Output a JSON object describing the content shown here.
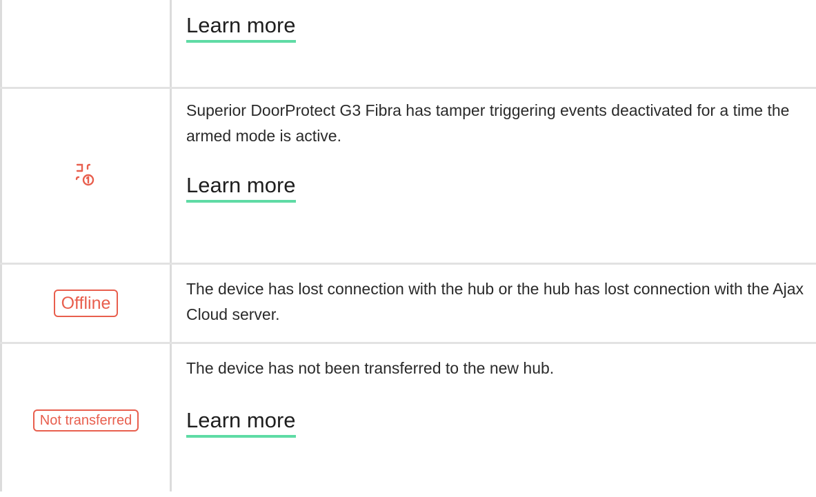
{
  "colors": {
    "accent_red": "#e85e4d",
    "link_underline": "#5fdba5",
    "border": "#dcdcdc"
  },
  "rows": [
    {
      "icon": "",
      "description": "",
      "link": "Learn more"
    },
    {
      "icon": "tamper-deactivated-icon",
      "description": "Superior DoorProtect G3 Fibra has tamper triggering events deactivated for a time the armed mode is active.",
      "link": "Learn more"
    },
    {
      "badge": "Offline",
      "description": "The device has lost connection with the hub or the hub has lost connection with the Ajax Cloud server."
    },
    {
      "badge": "Not transferred",
      "description": "The device has not been transferred to the new hub.",
      "link": "Learn more"
    }
  ]
}
